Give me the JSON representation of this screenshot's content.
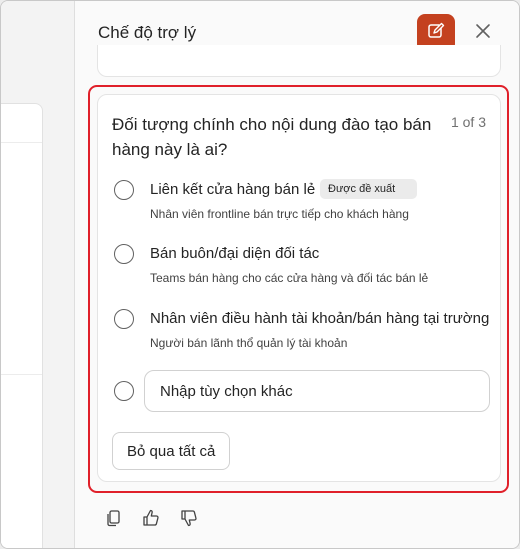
{
  "header": {
    "title": "Chế độ trợ lý"
  },
  "question_card": {
    "question": "Đối tượng chính cho nội dung đào tạo bán hàng này là ai?",
    "pager": "1 of 3",
    "options": [
      {
        "title": "Liên kết cửa hàng bán lẻ",
        "badge": "Được đề xuất",
        "description": "Nhân viên frontline bán trực tiếp cho khách hàng"
      },
      {
        "title": "Bán buôn/đại diện đối tác",
        "description": "Teams bán hàng cho các cửa hàng và đối tác bán lẻ"
      },
      {
        "title": "Nhân viên điều hành tài khoản/bán hàng tại trường",
        "description": "Người bán lãnh thổ quản lý tài khoản"
      }
    ],
    "other_placeholder": "Nhập tùy chọn khác",
    "skip_all_label": "Bỏ qua tất cả"
  },
  "colors": {
    "accent": "#c4411f",
    "highlight": "#e0202a"
  },
  "icons": {
    "new_chat": "compose-icon",
    "close": "close-icon",
    "copy": "copy-icon",
    "like": "thumbs-up-icon",
    "dislike": "thumbs-down-icon"
  }
}
